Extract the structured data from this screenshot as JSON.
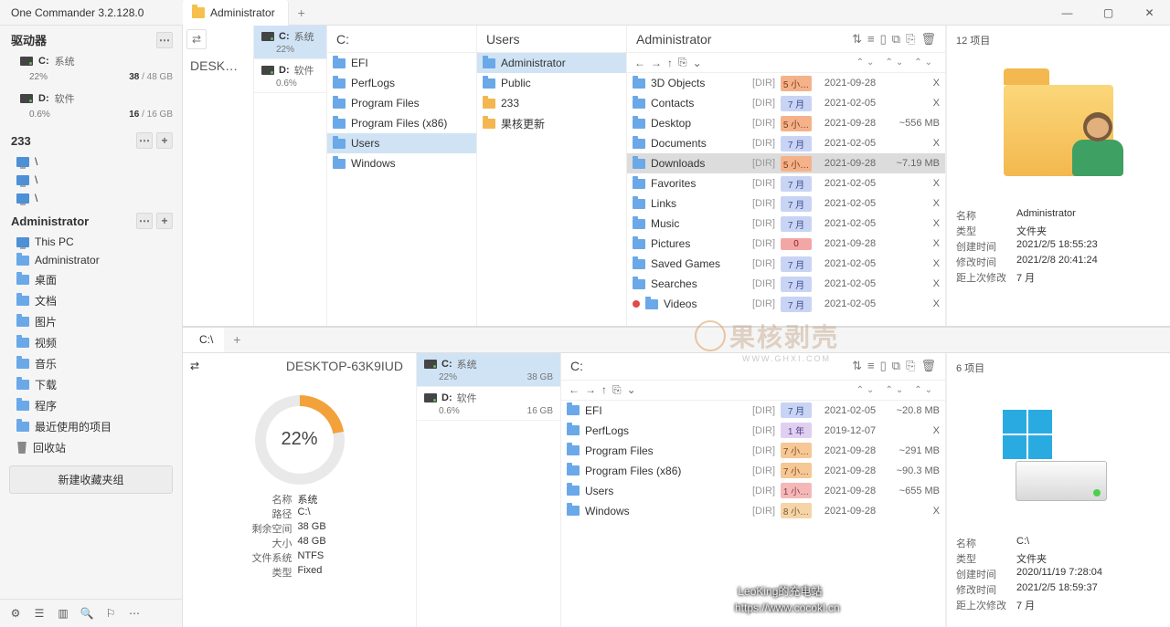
{
  "titlebar": {
    "appname": "One Commander 3.2.128.0",
    "tab": "Administrator",
    "minimize": "—",
    "maximize": "▢",
    "close": "✕"
  },
  "sidebar": {
    "drives_label": "驱动器",
    "drives": [
      {
        "letter": "C:",
        "name": "系统",
        "pct": "22%",
        "used": "38",
        "total": "/ 48 GB"
      },
      {
        "letter": "D:",
        "name": "软件",
        "pct": "0.6%",
        "used": "16",
        "total": "/ 16 GB"
      }
    ],
    "group233": "233",
    "group233_items": [
      "\\",
      "\\",
      "\\"
    ],
    "admin_label": "Administrator",
    "admin_items": [
      {
        "label": "This PC",
        "icon": "screen"
      },
      {
        "label": "Administrator",
        "icon": "folder"
      },
      {
        "label": "桌面",
        "icon": "folder"
      },
      {
        "label": "文档",
        "icon": "folder"
      },
      {
        "label": "图片",
        "icon": "folder"
      },
      {
        "label": "视频",
        "icon": "folder"
      },
      {
        "label": "音乐",
        "icon": "folder"
      },
      {
        "label": "下载",
        "icon": "folder"
      },
      {
        "label": "程序",
        "icon": "folder"
      },
      {
        "label": "最近使用的项目",
        "icon": "folder"
      },
      {
        "label": "回收站",
        "icon": "recycle"
      }
    ],
    "new_group_btn": "新建收藏夹组",
    "bottom_icons": [
      "⚙",
      "☰",
      "▥",
      "🔍",
      "⚐",
      "⋯"
    ]
  },
  "pane_top": {
    "tab": "Administrator",
    "desk_crumb": "DESK…",
    "drives": [
      {
        "letter": "C:",
        "name": "系统",
        "pct": "22%",
        "sel": true
      },
      {
        "letter": "D:",
        "name": "软件",
        "pct": "0.6%",
        "sel": false
      }
    ],
    "col_c": {
      "title": "C:",
      "items": [
        {
          "name": "EFI"
        },
        {
          "name": "PerfLogs"
        },
        {
          "name": "Program Files"
        },
        {
          "name": "Program Files (x86)"
        },
        {
          "name": "Users",
          "sel": "sel-blue"
        },
        {
          "name": "Windows"
        }
      ]
    },
    "col_users": {
      "title": "Users",
      "items": [
        {
          "name": "Administrator",
          "sel": "sel-blue"
        },
        {
          "name": "Public"
        },
        {
          "name": "233",
          "icon": "yellow"
        },
        {
          "name": "果核更新",
          "icon": "yellow"
        }
      ]
    },
    "col_admin": {
      "title": "Administrator",
      "nav": [
        "←",
        "→",
        "↑",
        "⎘",
        "⌄"
      ],
      "items": [
        {
          "name": "3D Objects",
          "dir": "[DIR]",
          "age": "5 小…",
          "ageClass": "age-orange",
          "date": "2021-09-28",
          "size": "X"
        },
        {
          "name": "Contacts",
          "dir": "[DIR]",
          "age": "7 月",
          "ageClass": "age-blue",
          "date": "2021-02-05",
          "size": "X"
        },
        {
          "name": "Desktop",
          "dir": "[DIR]",
          "age": "5 小…",
          "ageClass": "age-orange",
          "date": "2021-09-28",
          "size": "~556 MB"
        },
        {
          "name": "Documents",
          "dir": "[DIR]",
          "age": "7 月",
          "ageClass": "age-blue",
          "date": "2021-02-05",
          "size": "X"
        },
        {
          "name": "Downloads",
          "dir": "[DIR]",
          "age": "5 小…",
          "ageClass": "age-orange",
          "date": "2021-09-28",
          "size": "~7.19 MB",
          "sel": "sel-gray"
        },
        {
          "name": "Favorites",
          "dir": "[DIR]",
          "age": "7 月",
          "ageClass": "age-blue",
          "date": "2021-02-05",
          "size": "X"
        },
        {
          "name": "Links",
          "dir": "[DIR]",
          "age": "7 月",
          "ageClass": "age-blue",
          "date": "2021-02-05",
          "size": "X"
        },
        {
          "name": "Music",
          "dir": "[DIR]",
          "age": "7 月",
          "ageClass": "age-blue",
          "date": "2021-02-05",
          "size": "X"
        },
        {
          "name": "Pictures",
          "dir": "[DIR]",
          "age": "0",
          "ageClass": "age-red",
          "date": "2021-09-28",
          "size": "X"
        },
        {
          "name": "Saved Games",
          "dir": "[DIR]",
          "age": "7 月",
          "ageClass": "age-blue",
          "date": "2021-02-05",
          "size": "X"
        },
        {
          "name": "Searches",
          "dir": "[DIR]",
          "age": "7 月",
          "ageClass": "age-blue",
          "date": "2021-02-05",
          "size": "X"
        },
        {
          "name": "Videos",
          "dir": "[DIR]",
          "age": "7 月",
          "ageClass": "age-blue",
          "date": "2021-02-05",
          "size": "X",
          "reddot": true
        }
      ]
    },
    "detail": {
      "count": "12 项目",
      "props": [
        {
          "label": "名称",
          "val": "Administrator"
        },
        {
          "label": "类型",
          "val": "文件夹"
        },
        {
          "label": "创建时间",
          "val": "2021/2/5 18:55:23"
        },
        {
          "label": "修改时间",
          "val": "2021/2/8 20:41:24"
        },
        {
          "label": "距上次修改",
          "val": "7 月"
        }
      ]
    }
  },
  "pane_bottom": {
    "tab": "C:\\",
    "desk_crumb": "DESKTOP-63K9IUD",
    "drives": [
      {
        "letter": "C:",
        "name": "系统",
        "pct": "22%",
        "used": "38 GB",
        "sel": true
      },
      {
        "letter": "D:",
        "name": "软件",
        "pct": "0.6%",
        "used": "16 GB",
        "sel": false
      }
    ],
    "donut_pct": "22%",
    "drive_props": [
      {
        "label": "名称",
        "val": "系统"
      },
      {
        "label": "路径",
        "val": "C:\\"
      },
      {
        "label": "剩余空间",
        "val": "38 GB"
      },
      {
        "label": "大小",
        "val": "48 GB"
      },
      {
        "label": "文件系统",
        "val": "NTFS"
      },
      {
        "label": "类型",
        "val": "Fixed"
      }
    ],
    "col_c": {
      "title": "C:",
      "nav": [
        "←",
        "→",
        "↑",
        "⎘",
        "⌄"
      ],
      "items": [
        {
          "name": "EFI",
          "dir": "[DIR]",
          "age": "7 月",
          "ageClass": "age-blue",
          "date": "2021-02-05",
          "size": "~20.8 MB"
        },
        {
          "name": "PerfLogs",
          "dir": "[DIR]",
          "age": "1 年",
          "ageClass": "age-purple",
          "date": "2019-12-07",
          "size": "X"
        },
        {
          "name": "Program Files",
          "dir": "[DIR]",
          "age": "7 小…",
          "ageClass": "age-orange2",
          "date": "2021-09-28",
          "size": "~291 MB"
        },
        {
          "name": "Program Files (x86)",
          "dir": "[DIR]",
          "age": "7 小…",
          "ageClass": "age-orange2",
          "date": "2021-09-28",
          "size": "~90.3 MB"
        },
        {
          "name": "Users",
          "dir": "[DIR]",
          "age": "1 小…",
          "ageClass": "age-pink",
          "date": "2021-09-28",
          "size": "~655 MB"
        },
        {
          "name": "Windows",
          "dir": "[DIR]",
          "age": "8 小…",
          "ageClass": "age-orange3",
          "date": "2021-09-28",
          "size": "X"
        }
      ]
    },
    "detail": {
      "count": "6 项目",
      "props": [
        {
          "label": "名称",
          "val": "C:\\"
        },
        {
          "label": "类型",
          "val": "文件夹"
        },
        {
          "label": "创建时间",
          "val": "2020/11/19 7:28:04"
        },
        {
          "label": "修改时间",
          "val": "2021/2/5 18:59:37"
        },
        {
          "label": "距上次修改",
          "val": "7 月"
        }
      ]
    }
  },
  "watermark": {
    "text": "果核剥壳",
    "sub": "WWW.GHXI.COM"
  },
  "caption": {
    "line1": "LeoKing的充电站",
    "line2": "https://www.cocokl.cn"
  }
}
